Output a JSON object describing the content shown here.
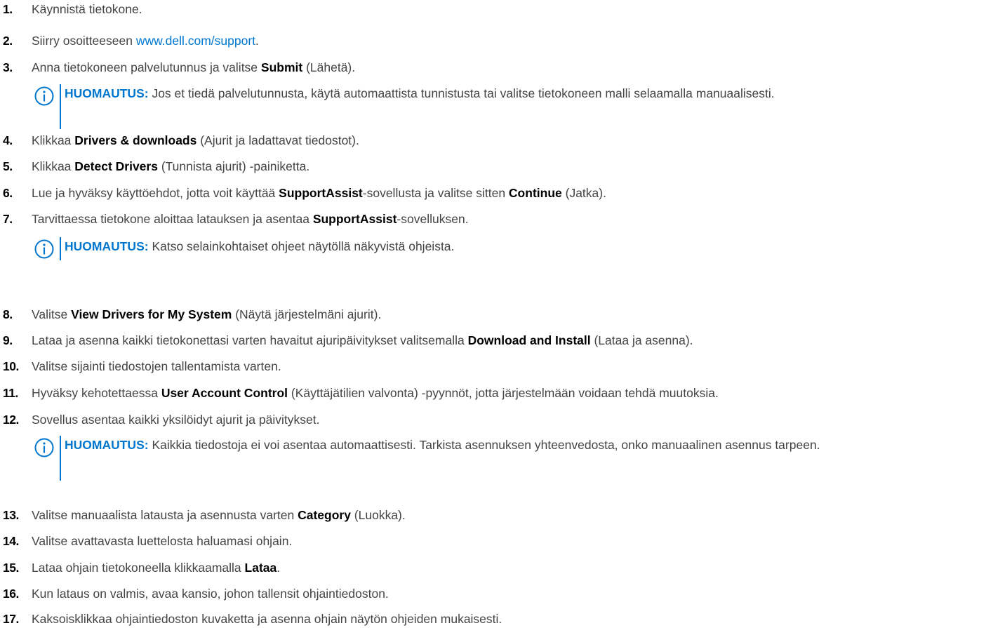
{
  "steps": [
    {
      "num": "1.",
      "parts": [
        {
          "t": "Käynnistä tietokone."
        }
      ]
    },
    {
      "num": "2.",
      "parts": [
        {
          "t": "Siirry osoitteeseen "
        },
        {
          "t": "www.dell.com/support",
          "link": true
        },
        {
          "t": "."
        }
      ]
    },
    {
      "num": "3.",
      "parts": [
        {
          "t": "Anna tietokoneen palvelutunnus ja valitse "
        },
        {
          "t": "Submit",
          "bold": true
        },
        {
          "t": " (Lähetä)."
        }
      ]
    },
    {
      "num": "4.",
      "parts": [
        {
          "t": "Klikkaa "
        },
        {
          "t": "Drivers & downloads",
          "bold": true
        },
        {
          "t": " (Ajurit ja ladattavat tiedostot)."
        }
      ]
    },
    {
      "num": "5.",
      "parts": [
        {
          "t": "Klikkaa "
        },
        {
          "t": "Detect Drivers",
          "bold": true
        },
        {
          "t": " (Tunnista ajurit) -painiketta."
        }
      ]
    },
    {
      "num": "6.",
      "parts": [
        {
          "t": "Lue ja hyväksy käyttöehdot, jotta voit käyttää "
        },
        {
          "t": "SupportAssist",
          "bold": true
        },
        {
          "t": "-sovellusta ja valitse sitten "
        },
        {
          "t": "Continue",
          "bold": true
        },
        {
          "t": " (Jatka)."
        }
      ]
    },
    {
      "num": "7.",
      "parts": [
        {
          "t": "Tarvittaessa tietokone aloittaa latauksen ja asentaa "
        },
        {
          "t": "SupportAssist",
          "bold": true
        },
        {
          "t": "-sovelluksen."
        }
      ]
    },
    {
      "num": "8.",
      "parts": [
        {
          "t": "Valitse "
        },
        {
          "t": "View Drivers for My System",
          "bold": true
        },
        {
          "t": " (Näytä järjestelmäni ajurit)."
        }
      ]
    },
    {
      "num": "9.",
      "parts": [
        {
          "t": "Lataa ja asenna kaikki tietokonettasi varten havaitut ajuripäivitykset valitsemalla "
        },
        {
          "t": "Download and Install",
          "bold": true
        },
        {
          "t": " (Lataa ja asenna)."
        }
      ]
    },
    {
      "num": "10.",
      "parts": [
        {
          "t": "Valitse sijainti tiedostojen tallentamista varten."
        }
      ]
    },
    {
      "num": "11.",
      "parts": [
        {
          "t": "Hyväksy kehotettaessa "
        },
        {
          "t": "User Account Control",
          "bold": true
        },
        {
          "t": " (Käyttäjätilien valvonta) -pyynnöt, jotta järjestelmään voidaan tehdä muutoksia."
        }
      ]
    },
    {
      "num": "12.",
      "parts": [
        {
          "t": "Sovellus asentaa kaikki yksilöidyt ajurit ja päivitykset."
        }
      ]
    },
    {
      "num": "13.",
      "parts": [
        {
          "t": "Valitse manuaalista latausta ja asennusta varten "
        },
        {
          "t": "Category",
          "bold": true
        },
        {
          "t": " (Luokka)."
        }
      ]
    },
    {
      "num": "14.",
      "parts": [
        {
          "t": "Valitse avattavasta luettelosta haluamasi ohjain."
        }
      ]
    },
    {
      "num": "15.",
      "parts": [
        {
          "t": "Lataa ohjain tietokoneella klikkaamalla "
        },
        {
          "t": "Lataa",
          "bold": true
        },
        {
          "t": "."
        }
      ]
    },
    {
      "num": "16.",
      "parts": [
        {
          "t": "Kun lataus on valmis, avaa kansio, johon tallensit ohjaintiedoston."
        }
      ]
    },
    {
      "num": "17.",
      "parts": [
        {
          "t": "Kaksoisklikkaa ohjaintiedoston kuvaketta ja asenna ohjain näytön ohjeiden mukaisesti."
        }
      ]
    }
  ],
  "notes": [
    {
      "label": "HUOMAUTUS:",
      "text": " Jos et tiedä palvelutunnusta, käytä automaattista tunnistusta tai valitse tietokoneen malli selaamalla manuaalisesti."
    },
    {
      "label": "HUOMAUTUS:",
      "text": " Katso selainkohtaiset ohjeet näytöllä näkyvistä ohjeista."
    },
    {
      "label": "HUOMAUTUS:",
      "text": " Kaikkia tiedostoja ei voi asentaa automaattisesti. Tarkista asennuksen yhteenvedosta, onko manuaalinen asennus tarpeen."
    }
  ],
  "colors": {
    "accent": "#0076ce",
    "text": "#444444",
    "strong": "#000000"
  }
}
